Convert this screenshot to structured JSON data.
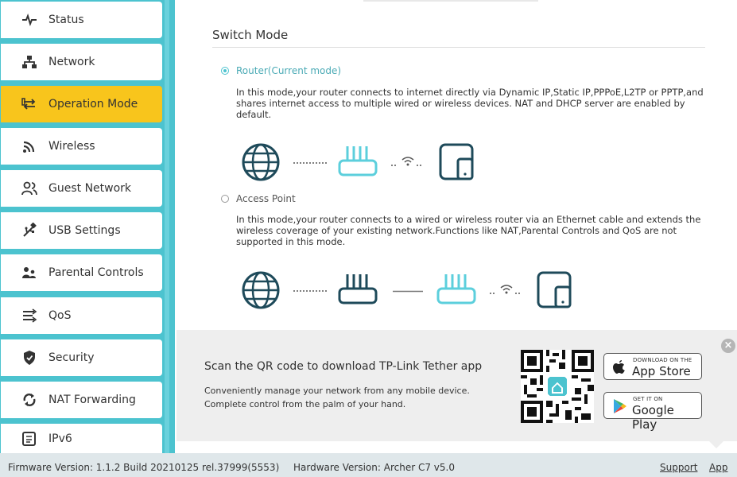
{
  "sidebar": {
    "items": [
      {
        "label": "Status",
        "icon": "pulse-icon",
        "active": false
      },
      {
        "label": "Network",
        "icon": "network-icon",
        "active": false
      },
      {
        "label": "Operation Mode",
        "icon": "operation-mode-icon",
        "active": true
      },
      {
        "label": "Wireless",
        "icon": "wireless-icon",
        "active": false
      },
      {
        "label": "Guest Network",
        "icon": "guest-icon",
        "active": false
      },
      {
        "label": "USB Settings",
        "icon": "usb-icon",
        "active": false
      },
      {
        "label": "Parental Controls",
        "icon": "parental-icon",
        "active": false
      },
      {
        "label": "QoS",
        "icon": "qos-icon",
        "active": false
      },
      {
        "label": "Security",
        "icon": "shield-icon",
        "active": false
      },
      {
        "label": "NAT Forwarding",
        "icon": "nat-icon",
        "active": false
      },
      {
        "label": "IPv6",
        "icon": "ipv6-icon",
        "active": false
      }
    ],
    "accent_color": "#4cc3cf",
    "active_color": "#f8c51c"
  },
  "main": {
    "title": "Switch Mode",
    "modes": [
      {
        "label": "Router(Current mode)",
        "selected": true,
        "description": "In this mode,your router connects to internet directly via Dynamic IP,Static IP,PPPoE,L2TP or PPTP,and shares internet access to multiple wired or wireless devices. NAT and DHCP server are enabled by default."
      },
      {
        "label": "Access Point",
        "selected": false,
        "description": "In this mode,your router connects to a wired or wireless router via an Ethernet cable and extends the wireless coverage of your existing network.Functions like NAT,Parental Controls and QoS are not supported in this mode."
      }
    ]
  },
  "promo": {
    "title": "Scan the QR code to download TP-Link Tether app",
    "line1": "Conveniently manage your network from any mobile device.",
    "line2": "Complete control from the palm of your hand.",
    "app_store_small": "DOWNLOAD ON THE",
    "app_store_big": "App Store",
    "google_small": "GET IT ON",
    "google_big": "Google Play",
    "close": "×"
  },
  "footer": {
    "firmware": "Firmware Version: 1.1.2 Build 20210125 rel.37999(5553)",
    "hardware": "Hardware Version: Archer C7 v5.0",
    "support": "Support",
    "app": "App"
  }
}
